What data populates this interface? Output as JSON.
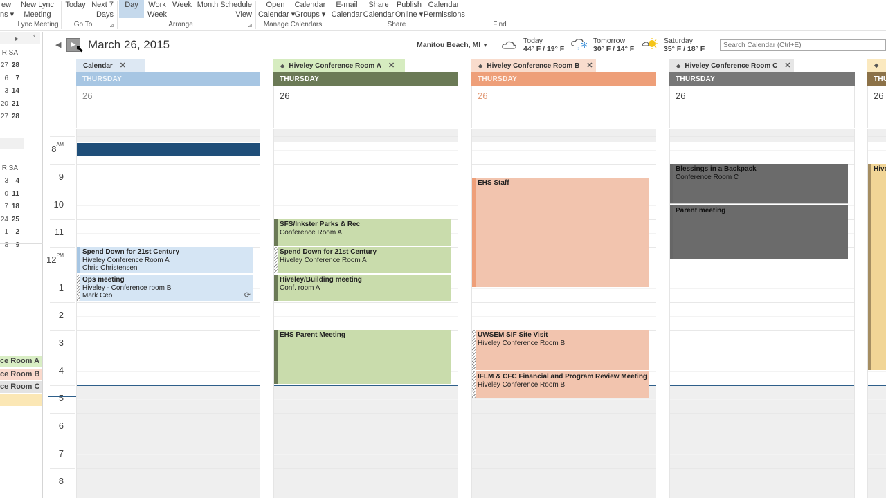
{
  "ribbon": {
    "buttons": [
      {
        "id": "new-items",
        "line1": "ew",
        "line2": "ns ▾"
      },
      {
        "id": "new-lync-meeting",
        "line1": "New Lync",
        "line2": "Meeting"
      },
      {
        "id": "today",
        "line1": "Today",
        "line2": ""
      },
      {
        "id": "next-7-days",
        "line1": "Next 7",
        "line2": "Days"
      },
      {
        "id": "day",
        "line1": "Day",
        "line2": "",
        "selected": true
      },
      {
        "id": "work-week",
        "line1": "Work",
        "line2": "Week"
      },
      {
        "id": "week",
        "line1": "Week",
        "line2": ""
      },
      {
        "id": "month",
        "line1": "Month",
        "line2": ""
      },
      {
        "id": "schedule-view",
        "line1": "Schedule",
        "line2": "View"
      },
      {
        "id": "open-calendar",
        "line1": "Open",
        "line2": "Calendar ▾"
      },
      {
        "id": "calendar-groups",
        "line1": "Calendar",
        "line2": "Groups ▾"
      },
      {
        "id": "email-calendar",
        "line1": "E-mail",
        "line2": "Calendar"
      },
      {
        "id": "share-calendar",
        "line1": "Share",
        "line2": "Calendar"
      },
      {
        "id": "publish-online",
        "line1": "Publish",
        "line2": "Online ▾"
      },
      {
        "id": "calendar-permissions",
        "line1": "Calendar",
        "line2": "Permissions"
      }
    ],
    "groups": [
      "Lync Meeting",
      "Go To",
      "Arrange",
      "Manage Calendars",
      "Share",
      "Find"
    ]
  },
  "header": {
    "date_title": "March 26, 2015",
    "location": "Manitou Beach, MI",
    "weather": [
      {
        "day": "Today",
        "temps": "44° F / 19° F",
        "icon": "cloudy-icon"
      },
      {
        "day": "Tomorrow",
        "temps": "30° F / 14° F",
        "icon": "snow-icon"
      },
      {
        "day": "Saturday",
        "temps": "35° F / 18° F",
        "icon": "partly-sunny-icon"
      }
    ],
    "search_placeholder": "Search Calendar (Ctrl+E)"
  },
  "mini_calendar": {
    "month1": {
      "headers": [
        "R",
        "SA"
      ],
      "rows": [
        [
          "27",
          "28"
        ],
        [
          "6",
          "7"
        ],
        [
          "3",
          "14"
        ],
        [
          "20",
          "21"
        ],
        [
          "27",
          "28"
        ]
      ]
    },
    "month2": {
      "headers": [
        "R",
        "SA"
      ],
      "rows": [
        [
          "3",
          "4"
        ],
        [
          "0",
          "11"
        ],
        [
          "7",
          "18"
        ],
        [
          "24",
          "25"
        ],
        [
          "1",
          "2"
        ],
        [
          "8",
          "9"
        ]
      ]
    }
  },
  "calendar_legend": [
    {
      "label": "ce Room A",
      "color": "#d9eec4"
    },
    {
      "label": "ce Room B",
      "color": "#fad9cc"
    },
    {
      "label": "ce Room C",
      "color": "#e3e3e3"
    },
    {
      "label": "",
      "color": "#fbe7b5"
    }
  ],
  "hours": [
    "8",
    "9",
    "10",
    "11",
    "12",
    "1",
    "2",
    "3",
    "4",
    "5",
    "6",
    "7",
    "8"
  ],
  "hour_suffix": {
    "am": "AM",
    "pm": "PM"
  },
  "columns": [
    {
      "tab": "Calendar",
      "day": "THURSDAY",
      "date": "26",
      "colors": {
        "tab": "#dde8f3",
        "header": "#a7c6e3",
        "date": "#888",
        "event": "#d5e5f4",
        "bar": "#a7c6e3"
      },
      "events": [
        {
          "title": "",
          "lines": [],
          "start": 8.0,
          "end": 8.5,
          "style": "dark"
        },
        {
          "title": "Spend Down for 21st Century",
          "lines": [
            "Hiveley Conference Room A",
            "Chris Christensen"
          ],
          "start": 12.0,
          "end": 13.0
        },
        {
          "title": "Ops meeting",
          "lines": [
            "Hiveley - Conference room B",
            "Mark Ceo"
          ],
          "start": 13.0,
          "end": 14.0,
          "hatch": true,
          "recurring": true
        }
      ]
    },
    {
      "tab": "Hiveley Conference Room A",
      "day": "THURSDAY",
      "date": "26",
      "colors": {
        "tab": "#d6ecc0",
        "header": "#6b7a56",
        "date": "#444",
        "event": "#c9dcac",
        "bar": "#6b7a56"
      },
      "events": [
        {
          "title": "SFS/Inkster Parks & Rec",
          "lines": [
            "Conference Room A"
          ],
          "start": 11.0,
          "end": 12.0
        },
        {
          "title": "Spend Down for 21st Century",
          "lines": [
            "Hiveley Conference Room A"
          ],
          "start": 12.0,
          "end": 13.0,
          "hatch": true
        },
        {
          "title": "Hiveley/Building meeting",
          "lines": [
            "Conf. room A"
          ],
          "start": 13.0,
          "end": 14.0
        },
        {
          "title": "EHS Parent Meeting",
          "lines": [],
          "start": 15.0,
          "end": 17.0
        }
      ]
    },
    {
      "tab": "Hiveley Conference Room B",
      "day": "THURSDAY",
      "date": "26",
      "colors": {
        "tab": "#f9dccd",
        "header": "#ee9f79",
        "date": "#e29b78",
        "event": "#f2c4ae",
        "bar": "#ee9f79"
      },
      "events": [
        {
          "title": "EHS Staff",
          "lines": [],
          "start": 9.5,
          "end": 13.5
        },
        {
          "title": "UWSEM SIF Site Visit",
          "lines": [
            "Hiveley Conference Room B"
          ],
          "start": 15.0,
          "end": 16.5,
          "hatch": true
        },
        {
          "title": "IFLM & CFC Financial and Program Review Meeting",
          "lines": [
            "Hiveley Conference Room B"
          ],
          "start": 16.5,
          "end": 17.5,
          "hatch": true
        }
      ]
    },
    {
      "tab": "Hiveley Conference Room C",
      "day": "THURSDAY",
      "date": "26",
      "colors": {
        "tab": "#e6e6e6",
        "header": "#777777",
        "date": "#444",
        "event": "#6b6b6b",
        "bar": "#6b6b6b"
      },
      "events": [
        {
          "title": "Blessings in a Backpack",
          "lines": [
            "Conference Room C"
          ],
          "start": 9.0,
          "end": 10.5,
          "style": "gray"
        },
        {
          "title": "Parent meeting",
          "lines": [],
          "start": 10.5,
          "end": 12.5,
          "style": "gray"
        }
      ]
    },
    {
      "tab": "",
      "day": "THU",
      "date": "26",
      "colors": {
        "tab": "#fbe9bf",
        "header": "#8c7248",
        "date": "#444",
        "event": "#f1d596",
        "bar": "#a58e62"
      },
      "events": [
        {
          "title": "Hive",
          "lines": [],
          "start": 9.0,
          "end": 16.5
        }
      ]
    }
  ]
}
